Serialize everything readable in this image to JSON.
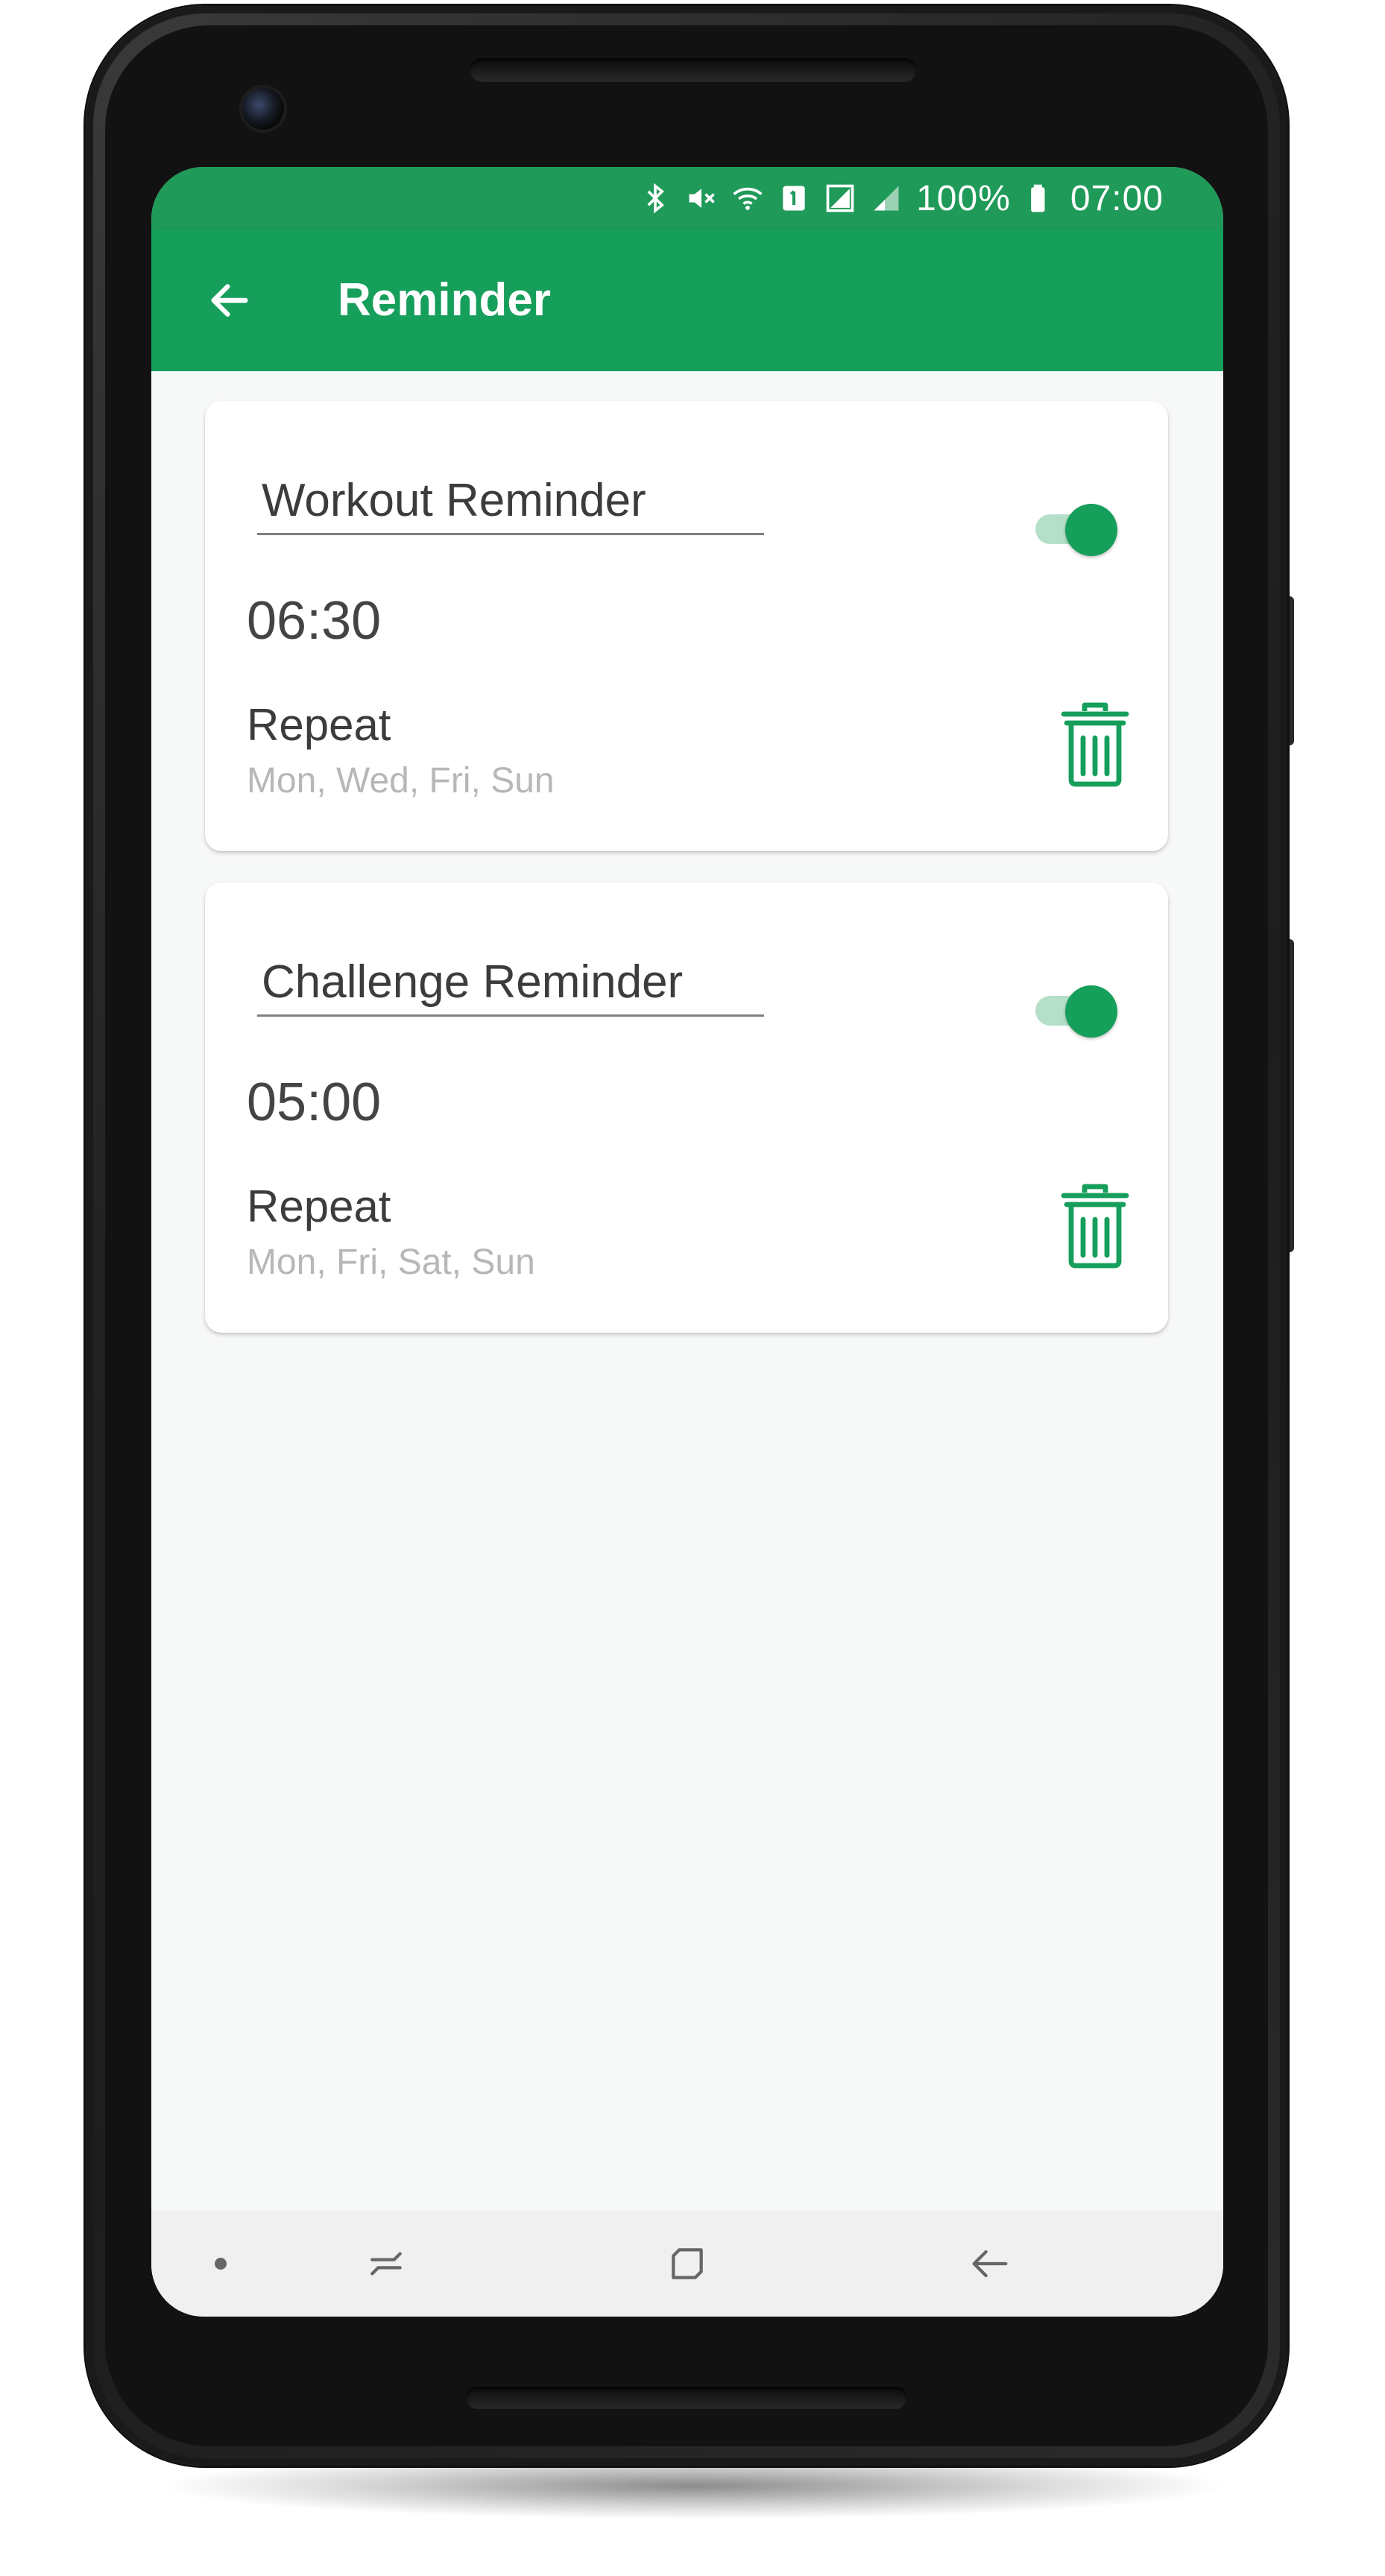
{
  "status_bar": {
    "battery": "100%",
    "time": "07:00",
    "icons": [
      "bluetooth-icon",
      "mute-icon",
      "wifi-icon",
      "sim-icon",
      "signal-icon",
      "signal-icon",
      "battery-icon"
    ]
  },
  "app_bar": {
    "title": "Reminder",
    "back_icon": "arrow-back-icon"
  },
  "reminders": [
    {
      "name": "Workout Reminder",
      "time": "06:30",
      "repeat_label": "Repeat",
      "repeat_days": "Mon, Wed, Fri, Sun",
      "enabled": true
    },
    {
      "name": "Challenge Reminder",
      "time": "05:00",
      "repeat_label": "Repeat",
      "repeat_days": "Mon, Fri, Sat, Sun",
      "enabled": true
    }
  ],
  "fab": {
    "icon": "plus-icon"
  },
  "nav_bar": {
    "icons": [
      "dot-icon",
      "recents-icon",
      "home-icon",
      "back-icon"
    ]
  },
  "colors": {
    "primary": "#169e5b",
    "status_bar": "#1f9a59",
    "toggle_track": "#b4dfc8",
    "background": "#f7f8f8"
  }
}
